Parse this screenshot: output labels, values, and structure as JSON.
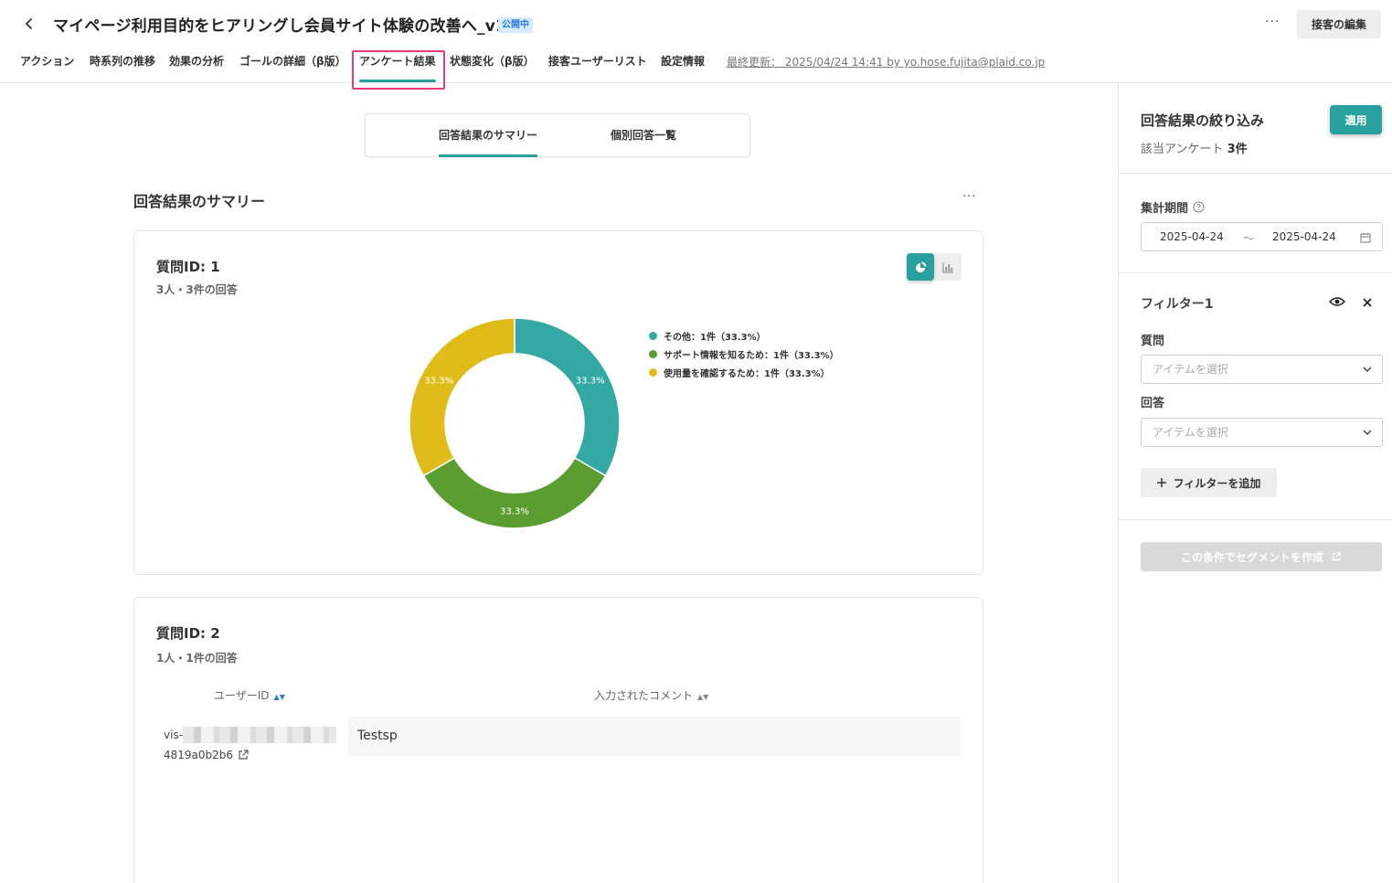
{
  "header": {
    "title": "マイページ利用目的をヒアリングし会員サイト体験の改善へ_v1.0",
    "status_badge": "公開中",
    "more_label": "···",
    "edit_button": "接客の編集"
  },
  "tabs": [
    "アクション",
    "時系列の推移",
    "効果の分析",
    "ゴールの詳細（β版）",
    "アンケート結果",
    "状態変化（β版）",
    "接客ユーザーリスト",
    "設定情報"
  ],
  "active_tab": "アンケート結果",
  "last_updated": "最終更新： 2025/04/24 14:41 by yo.hose.fujita@plaid.co.jp",
  "subtabs": [
    "回答結果のサマリー",
    "個別回答一覧"
  ],
  "section": {
    "title": "回答結果のサマリー",
    "more_label": "···"
  },
  "question1": {
    "title": "質問ID: 1",
    "subtitle": "3人・3件の回答",
    "chart_icons": [
      "pie-chart-icon",
      "bar-chart-icon"
    ]
  },
  "chart_data": {
    "type": "pie",
    "donut": true,
    "categories": [
      "その他",
      "サポート情報を知るため",
      "使用量を確認するため"
    ],
    "values": [
      1,
      1,
      1
    ],
    "percent_labels": [
      "33.3%",
      "33.3%",
      "33.3%"
    ],
    "colors": [
      "#34a9a3",
      "#5a9e32",
      "#e0bc1a"
    ],
    "legend": [
      "その他：1件（33.3%）",
      "サポート情報を知るため：1件（33.3%）",
      "使用量を確認するため：1件（33.3%）"
    ],
    "legend_position": "right"
  },
  "question2": {
    "title": "質問ID: 2",
    "subtitle": "1人・1件の回答",
    "columns": [
      "ユーザーID",
      "入力されたコメント"
    ],
    "rows": [
      {
        "user_id_prefix": "vis-",
        "user_id_suffix": "4819a0b2b6",
        "comment": "Testsp"
      }
    ]
  },
  "right_panel": {
    "title": "回答結果の絞り込み",
    "apply_button": "適用",
    "count_prefix": "該当アンケート",
    "count_value": "3件",
    "period_label": "集計期間",
    "date_from": "2025-04-24",
    "date_sep": "〜",
    "date_to": "2025-04-24",
    "filter_title": "フィルター1",
    "question_label": "質問",
    "question_placeholder": "アイテムを選択",
    "answer_label": "回答",
    "answer_placeholder": "アイテムを選択",
    "add_filter_button": "フィルターを追加",
    "segment_button": "この条件でセグメントを作成"
  }
}
